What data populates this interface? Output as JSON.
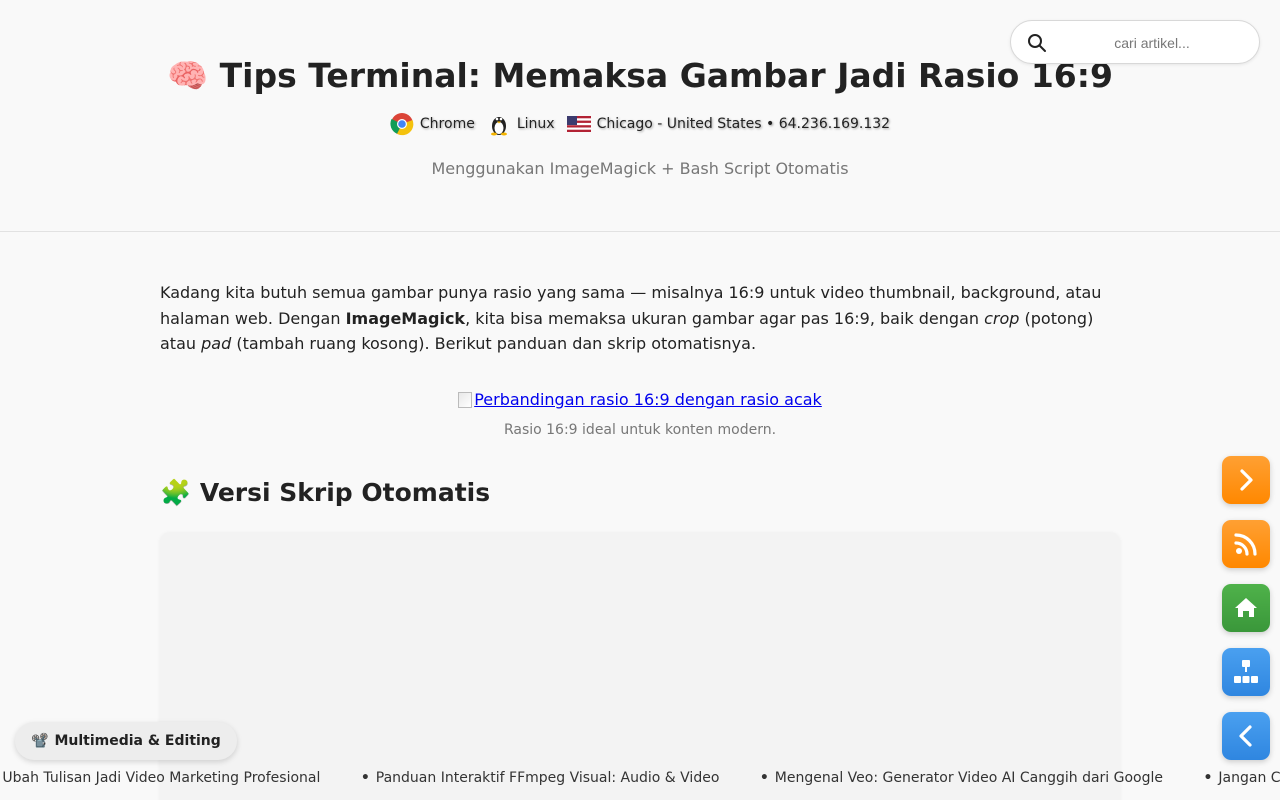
{
  "header": {
    "title_emoji": "🧠",
    "title": "Tips Terminal: Memaksa Gambar Jadi Rasio 16:9",
    "meta": {
      "browser": "Chrome",
      "os": "Linux",
      "location": "Chicago - United States • 64.236.169.132"
    },
    "subtitle": "Menggunakan ImageMagick + Bash Script Otomatis"
  },
  "search": {
    "placeholder": "cari artikel..."
  },
  "article": {
    "intro_part1": "Kadang kita butuh semua gambar punya rasio yang sama — misalnya 16:9 untuk video thumbnail, background, atau halaman web. Dengan ",
    "intro_bold": "ImageMagick",
    "intro_part2": ", kita bisa memaksa ukuran gambar agar pas 16:9, baik dengan ",
    "intro_italic1": "crop",
    "intro_part3": " (potong) atau ",
    "intro_italic2": "pad",
    "intro_part4": " (tambah ruang kosong). Berikut panduan dan skrip otomatisnya.",
    "figure_alt": "Perbandingan rasio 16:9 dengan rasio acak",
    "figure_caption": "Rasio 16:9 ideal untuk konten modern.",
    "section_emoji": "🧩",
    "section_heading": "Versi Skrip Otomatis"
  },
  "category": {
    "emoji": "📽️",
    "label": "Multimedia & Editing"
  },
  "ticker": [
    "y.ai: Ubah Tulisan Jadi Video Marketing Profesional",
    "Panduan Interaktif FFmpeg Visual: Audio & Video",
    "Mengenal Veo: Generator Video AI Canggih dari Google",
    "Jangan Cum"
  ],
  "colors": {
    "orange": "#ff8800",
    "green": "#3a973a",
    "blue": "#2f86e0",
    "link": "#0000ee"
  },
  "icons": [
    "search-icon",
    "chrome-icon",
    "linux-icon",
    "us-flag-icon",
    "chevron-right-icon",
    "rss-icon",
    "home-icon",
    "sitemap-icon",
    "chevron-left-icon"
  ]
}
